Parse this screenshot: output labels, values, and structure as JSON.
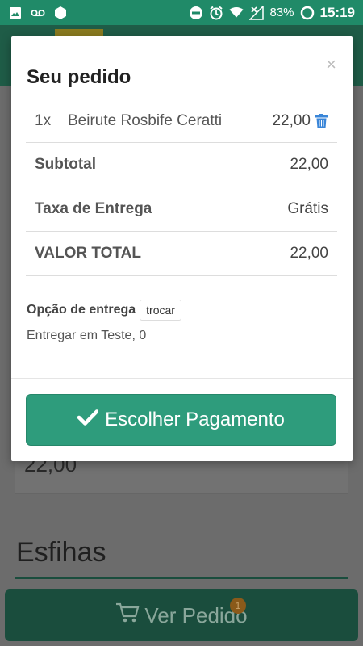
{
  "status_bar": {
    "battery": "83%",
    "time": "15:19",
    "icons": [
      "gallery-icon",
      "voicemail-icon",
      "hexagon-app-icon",
      "dnd-icon",
      "alarm-icon",
      "wifi-icon",
      "no-signal-icon",
      "battery-ring-icon"
    ]
  },
  "background": {
    "card_price": "22,00",
    "section_title": "Esfihas",
    "cart_button": {
      "label": "Ver Pedido",
      "badge": "1"
    }
  },
  "modal": {
    "title": "Seu pedido",
    "close_label": "×",
    "items": [
      {
        "qty": "1x",
        "name": "Beirute Rosbife Ceratti",
        "price": "22,00"
      }
    ],
    "summary": [
      {
        "label": "Subtotal",
        "value": "22,00"
      },
      {
        "label": "Taxa de Entrega",
        "value": "Grátis"
      },
      {
        "label": "VALOR TOTAL",
        "value": "22,00"
      }
    ],
    "delivery_option_label": "Opção de entrega",
    "change_label": "trocar",
    "delivery_address": "Entregar em Teste, 0",
    "pay_button_label": "Escolher Pagamento"
  },
  "colors": {
    "status_bar": "#208a68",
    "primary_button": "#2e9c7c",
    "trash_icon": "#3a86d8",
    "overlay_dim": "#6c6c6c"
  }
}
